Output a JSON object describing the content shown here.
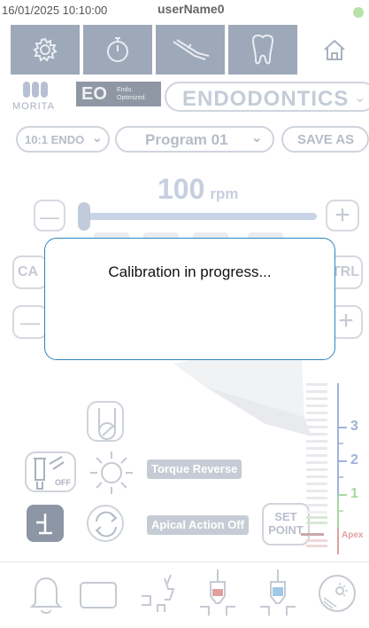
{
  "status": {
    "datetime": "16/01/2025 10:10:00",
    "user": "userName0"
  },
  "toolbar": {
    "icons": [
      "gear-icon",
      "stopwatch-icon",
      "handpiece-icon",
      "tooth-icon",
      "home-icon"
    ]
  },
  "brand": {
    "logo": "MORITA",
    "eo_mark": "EO",
    "eo_caption_1": "Endo.",
    "eo_caption_2": "Optimized."
  },
  "mode_select": {
    "value": "ENDODONTICS"
  },
  "ratio_select": {
    "value": "10:1 ENDO"
  },
  "program_select": {
    "value": "Program 01"
  },
  "save_as_label": "SAVE AS",
  "speed": {
    "value": "100",
    "unit": "rpm"
  },
  "buttons": {
    "minus": "—",
    "plus": "+",
    "cal_partial": "CA",
    "ctrl_partial": "TRL"
  },
  "dialog": {
    "message": "Calibration in progress..."
  },
  "controls": {
    "torque_reverse": "Torque Reverse",
    "apical_action": "Apical Action Off",
    "setpoint_line1": "SET",
    "setpoint_line2": "POINT",
    "off_label": "OFF"
  },
  "gauge": {
    "labels": [
      "3",
      "2",
      "1"
    ],
    "apex_label": "Apex"
  },
  "bottom_icons": [
    "bell-icon",
    "display-icon",
    "root-canal-icon",
    "root-canal-red-icon",
    "root-canal-blue-icon",
    "light-sensor-icon"
  ],
  "colors": {
    "toolbar": "#9da8b9",
    "dialog_border": "#2e86c1",
    "gauge_blue": "#9fb2d8",
    "gauge_green": "#a9d8a0",
    "gauge_red": "#e0a0a0"
  }
}
